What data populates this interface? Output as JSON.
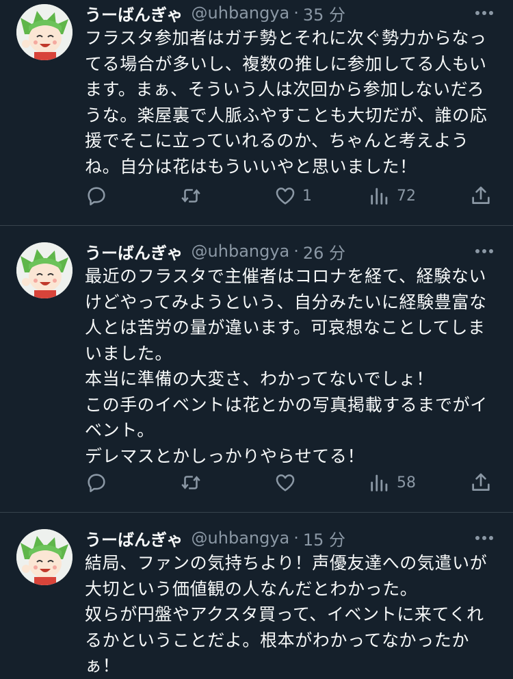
{
  "colors": {
    "background": "#15202b",
    "text": "#f7f9f9",
    "secondary": "#8b98a5",
    "divider": "#38444d"
  },
  "tweets": [
    {
      "name": "うーばんぎゃ",
      "handle": "@uhbangya",
      "separator": "·",
      "time": "35 分",
      "lines": [
        "フラスタ参加者はガチ勢とそれに次ぐ勢力からなっ",
        "てる場合が多いし、複数の推しに参加してる人もい",
        "ます。まぁ、そういう人は次回から参加しないだろ",
        "うな。楽屋裏で人脈ふやすことも大切だが、誰の応",
        "援でそこに立っていれるのか、ちゃんと考えよう",
        "ね。自分は花はもういいやと思いました！"
      ],
      "likes": "1",
      "views": "72"
    },
    {
      "name": "うーばんぎゃ",
      "handle": "@uhbangya",
      "separator": "·",
      "time": "26 分",
      "lines": [
        "最近のフラスタで主催者はコロナを経て、経験ない",
        "けどやってみようという、自分みたいに経験豊富な",
        "人とは苦労の量が違います。可哀想なことしてしま",
        "いました。",
        "本当に準備の大変さ、わかってないでしょ！",
        "この手のイベントは花とかの写真掲載するまでがイ",
        "ベント。",
        "デレマスとかしっかりやらせてる！"
      ],
      "likes": "",
      "views": "58"
    },
    {
      "name": "うーばんぎゃ",
      "handle": "@uhbangya",
      "separator": "·",
      "time": "15 分",
      "lines": [
        "結局、ファンの気持ちより！声優友達への気遣いが",
        "大切という価値観の人なんだとわかった。",
        "奴らが円盤やアクスタ買って、イベントに来てくれ",
        "るかということだよ。根本がわかってなかったか",
        "ぁ！"
      ]
    }
  ]
}
